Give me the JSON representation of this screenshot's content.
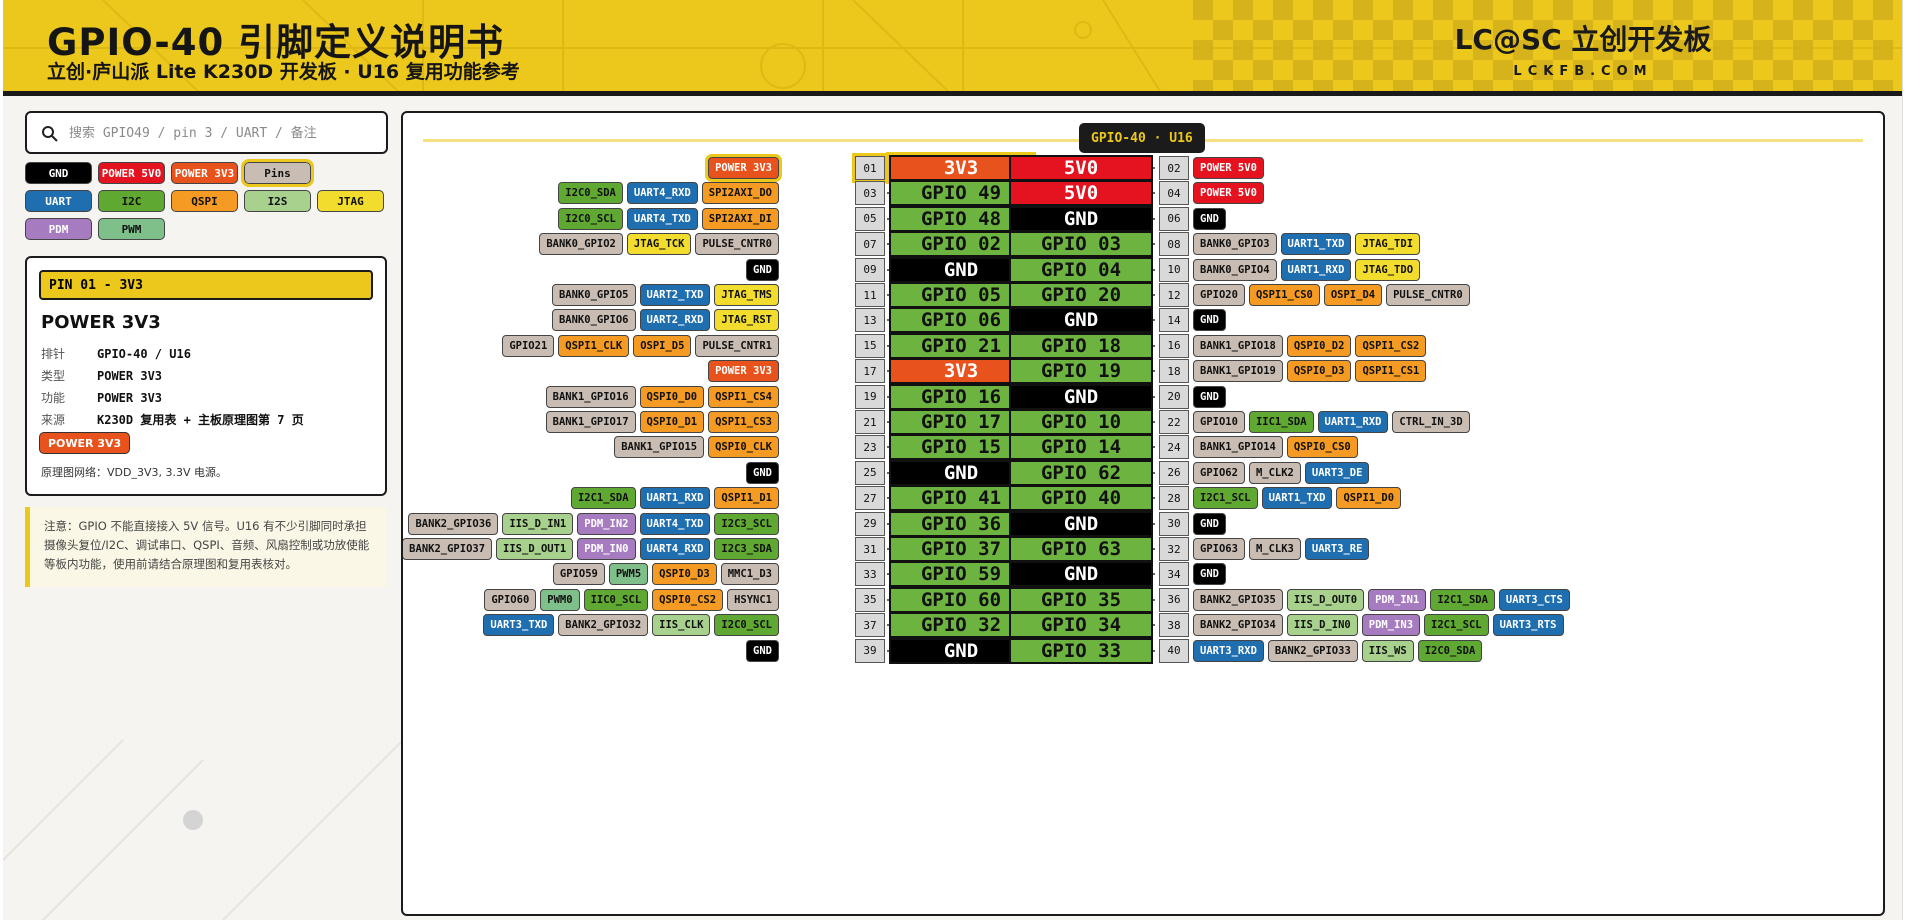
{
  "header": {
    "title": "GPIO-40 引脚定义说明书",
    "subtitle": "立创·庐山派 Lite K230D 开发板 · U16 复用功能参考",
    "brand": "LC@SC 立创开发板",
    "brand_url": "LCKFB.COM"
  },
  "search": {
    "placeholder": "搜索 GPIO49 / pin 3 / UART / 备注",
    "icon": "search-icon"
  },
  "legend": [
    {
      "label": "GND",
      "type": "GND"
    },
    {
      "label": "POWER 5V0",
      "type": "P5"
    },
    {
      "label": "POWER 3V3",
      "type": "P3"
    },
    {
      "label": "Pins",
      "type": "PIN",
      "selected": true
    },
    {
      "label": "UART",
      "type": "UART"
    },
    {
      "label": "I2C",
      "type": "I2C"
    },
    {
      "label": "QSPI",
      "type": "QSPI"
    },
    {
      "label": "I2S",
      "type": "I2S"
    },
    {
      "label": "JTAG",
      "type": "JTAG"
    },
    {
      "label": "PDM",
      "type": "PDM"
    },
    {
      "label": "PWM",
      "type": "PWM"
    }
  ],
  "info": {
    "header": "PIN 01 - 3V3",
    "name": "POWER 3V3",
    "rows": [
      {
        "k": "排针",
        "v": "GPIO-40 / U16"
      },
      {
        "k": "类型",
        "v": "POWER 3V3"
      },
      {
        "k": "功能",
        "v": "POWER 3V3"
      },
      {
        "k": "来源",
        "v": "K230D 复用表 + 主板原理图第 7 页"
      }
    ],
    "tag": "POWER 3V3",
    "note": "原理图网络：VDD_3V3, 3.3V 电源。"
  },
  "warning": "注意：GPIO 不能直接接入 5V 信号。U16 有不少引脚同时承担摄像头复位/I2C、调试串口、QSPI、音频、风扇控制或功放使能等板内功能，使用前请结合原理图和复用表核对。",
  "board_title": "GPIO-40 · U16",
  "colors": {
    "GND": "#000000",
    "P5": "#e5121f",
    "P3": "#e8521d",
    "GPIO": "#6cb33f",
    "UART": "#1f6eaf",
    "I2C": "#5fa832",
    "QSPI": "#f59b23",
    "I2S": "#a9d18e",
    "JTAG": "#f2dc2e",
    "PDM": "#a77bbf",
    "PWM": "#7fc08a",
    "MISC": "#c9bdb3",
    "accent": "#ecc81c"
  },
  "pins": [
    {
      "ln": "01",
      "rn": "02",
      "l": "3V3",
      "lt": "P3",
      "r": "5V0",
      "rt": "P5",
      "lf": [
        {
          "t": "POWER 3V3",
          "c": "P3",
          "sel": true
        }
      ],
      "rf": [
        {
          "t": "POWER 5V0",
          "c": "P5"
        }
      ]
    },
    {
      "ln": "03",
      "rn": "04",
      "l": "GPIO 49",
      "lt": "GPIO",
      "r": "5V0",
      "rt": "P5",
      "lf": [
        {
          "t": "I2C0_SDA",
          "c": "I2C"
        },
        {
          "t": "UART4_RXD",
          "c": "UART"
        },
        {
          "t": "SPI2AXI_DO",
          "c": "QSPI"
        }
      ],
      "rf": [
        {
          "t": "POWER 5V0",
          "c": "P5"
        }
      ]
    },
    {
      "ln": "05",
      "rn": "06",
      "l": "GPIO 48",
      "lt": "GPIO",
      "r": "GND",
      "rt": "GND",
      "lf": [
        {
          "t": "I2C0_SCL",
          "c": "I2C"
        },
        {
          "t": "UART4_TXD",
          "c": "UART"
        },
        {
          "t": "SPI2AXI_DI",
          "c": "QSPI"
        }
      ],
      "rf": [
        {
          "t": "GND",
          "c": "GND"
        }
      ]
    },
    {
      "ln": "07",
      "rn": "08",
      "l": "GPIO 02",
      "lt": "GPIO",
      "r": "GPIO 03",
      "rt": "GPIO",
      "lf": [
        {
          "t": "BANK0_GPIO2",
          "c": "MISC"
        },
        {
          "t": "JTAG_TCK",
          "c": "JTAG"
        },
        {
          "t": "PULSE_CNTR0",
          "c": "MISC"
        }
      ],
      "rf": [
        {
          "t": "BANK0_GPIO3",
          "c": "MISC"
        },
        {
          "t": "UART1_TXD",
          "c": "UART"
        },
        {
          "t": "JTAG_TDI",
          "c": "JTAG"
        }
      ]
    },
    {
      "ln": "09",
      "rn": "10",
      "l": "GND",
      "lt": "GND",
      "r": "GPIO 04",
      "rt": "GPIO",
      "lf": [
        {
          "t": "GND",
          "c": "GND"
        }
      ],
      "rf": [
        {
          "t": "BANK0_GPIO4",
          "c": "MISC"
        },
        {
          "t": "UART1_RXD",
          "c": "UART"
        },
        {
          "t": "JTAG_TDO",
          "c": "JTAG"
        }
      ]
    },
    {
      "ln": "11",
      "rn": "12",
      "l": "GPIO 05",
      "lt": "GPIO",
      "r": "GPIO 20",
      "rt": "GPIO",
      "lf": [
        {
          "t": "BANK0_GPIO5",
          "c": "MISC"
        },
        {
          "t": "UART2_TXD",
          "c": "UART"
        },
        {
          "t": "JTAG_TMS",
          "c": "JTAG"
        }
      ],
      "rf": [
        {
          "t": "GPIO20",
          "c": "MISC"
        },
        {
          "t": "QSPI1_CS0",
          "c": "QSPI"
        },
        {
          "t": "OSPI_D4",
          "c": "QSPI"
        },
        {
          "t": "PULSE_CNTR0",
          "c": "MISC"
        }
      ]
    },
    {
      "ln": "13",
      "rn": "14",
      "l": "GPIO 06",
      "lt": "GPIO",
      "r": "GND",
      "rt": "GND",
      "lf": [
        {
          "t": "BANK0_GPIO6",
          "c": "MISC"
        },
        {
          "t": "UART2_RXD",
          "c": "UART"
        },
        {
          "t": "JTAG_RST",
          "c": "JTAG"
        }
      ],
      "rf": [
        {
          "t": "GND",
          "c": "GND"
        }
      ]
    },
    {
      "ln": "15",
      "rn": "16",
      "l": "GPIO 21",
      "lt": "GPIO",
      "r": "GPIO 18",
      "rt": "GPIO",
      "lf": [
        {
          "t": "GPIO21",
          "c": "MISC"
        },
        {
          "t": "QSPI1_CLK",
          "c": "QSPI"
        },
        {
          "t": "OSPI_D5",
          "c": "QSPI"
        },
        {
          "t": "PULSE_CNTR1",
          "c": "MISC"
        }
      ],
      "rf": [
        {
          "t": "BANK1_GPIO18",
          "c": "MISC"
        },
        {
          "t": "QSPI0_D2",
          "c": "QSPI"
        },
        {
          "t": "QSPI1_CS2",
          "c": "QSPI"
        }
      ]
    },
    {
      "ln": "17",
      "rn": "18",
      "l": "3V3",
      "lt": "P3",
      "r": "GPIO 19",
      "rt": "GPIO",
      "lf": [
        {
          "t": "POWER 3V3",
          "c": "P3"
        }
      ],
      "rf": [
        {
          "t": "BANK1_GPIO19",
          "c": "MISC"
        },
        {
          "t": "QSPI0_D3",
          "c": "QSPI"
        },
        {
          "t": "QSPI1_CS1",
          "c": "QSPI"
        }
      ]
    },
    {
      "ln": "19",
      "rn": "20",
      "l": "GPIO 16",
      "lt": "GPIO",
      "r": "GND",
      "rt": "GND",
      "lf": [
        {
          "t": "BANK1_GPIO16",
          "c": "MISC"
        },
        {
          "t": "QSPI0_D0",
          "c": "QSPI"
        },
        {
          "t": "QSPI1_CS4",
          "c": "QSPI"
        }
      ],
      "rf": [
        {
          "t": "GND",
          "c": "GND"
        }
      ]
    },
    {
      "ln": "21",
      "rn": "22",
      "l": "GPIO 17",
      "lt": "GPIO",
      "r": "GPIO 10",
      "rt": "GPIO",
      "lf": [
        {
          "t": "BANK1_GPIO17",
          "c": "MISC"
        },
        {
          "t": "QSPI0_D1",
          "c": "QSPI"
        },
        {
          "t": "QSPI1_CS3",
          "c": "QSPI"
        }
      ],
      "rf": [
        {
          "t": "GPIO10",
          "c": "MISC"
        },
        {
          "t": "IIC1_SDA",
          "c": "I2C"
        },
        {
          "t": "UART1_RXD",
          "c": "UART"
        },
        {
          "t": "CTRL_IN_3D",
          "c": "MISC"
        }
      ]
    },
    {
      "ln": "23",
      "rn": "24",
      "l": "GPIO 15",
      "lt": "GPIO",
      "r": "GPIO 14",
      "rt": "GPIO",
      "lf": [
        {
          "t": "BANK1_GPIO15",
          "c": "MISC"
        },
        {
          "t": "QSPI0_CLK",
          "c": "QSPI"
        }
      ],
      "rf": [
        {
          "t": "BANK1_GPIO14",
          "c": "MISC"
        },
        {
          "t": "QSPI0_CS0",
          "c": "QSPI"
        }
      ]
    },
    {
      "ln": "25",
      "rn": "26",
      "l": "GND",
      "lt": "GND",
      "r": "GPIO 62",
      "rt": "GPIO",
      "lf": [
        {
          "t": "GND",
          "c": "GND"
        }
      ],
      "rf": [
        {
          "t": "GPIO62",
          "c": "MISC"
        },
        {
          "t": "M_CLK2",
          "c": "MISC"
        },
        {
          "t": "UART3_DE",
          "c": "UART"
        }
      ]
    },
    {
      "ln": "27",
      "rn": "28",
      "l": "GPIO 41",
      "lt": "GPIO",
      "r": "GPIO 40",
      "rt": "GPIO",
      "lf": [
        {
          "t": "I2C1_SDA",
          "c": "I2C"
        },
        {
          "t": "UART1_RXD",
          "c": "UART"
        },
        {
          "t": "QSPI1_D1",
          "c": "QSPI"
        }
      ],
      "rf": [
        {
          "t": "I2C1_SCL",
          "c": "I2C"
        },
        {
          "t": "UART1_TXD",
          "c": "UART"
        },
        {
          "t": "QSPI1_D0",
          "c": "QSPI"
        }
      ]
    },
    {
      "ln": "29",
      "rn": "30",
      "l": "GPIO 36",
      "lt": "GPIO",
      "r": "GND",
      "rt": "GND",
      "lf": [
        {
          "t": "BANK2_GPIO36",
          "c": "MISC"
        },
        {
          "t": "IIS_D_IN1",
          "c": "I2S"
        },
        {
          "t": "PDM_IN2",
          "c": "PDM"
        },
        {
          "t": "UART4_TXD",
          "c": "UART"
        },
        {
          "t": "I2C3_SCL",
          "c": "I2C"
        }
      ],
      "rf": [
        {
          "t": "GND",
          "c": "GND"
        }
      ]
    },
    {
      "ln": "31",
      "rn": "32",
      "l": "GPIO 37",
      "lt": "GPIO",
      "r": "GPIO 63",
      "rt": "GPIO",
      "lf": [
        {
          "t": "BANK2_GPIO37",
          "c": "MISC"
        },
        {
          "t": "IIS_D_OUT1",
          "c": "I2S"
        },
        {
          "t": "PDM_IN0",
          "c": "PDM"
        },
        {
          "t": "UART4_RXD",
          "c": "UART"
        },
        {
          "t": "I2C3_SDA",
          "c": "I2C"
        }
      ],
      "rf": [
        {
          "t": "GPIO63",
          "c": "MISC"
        },
        {
          "t": "M_CLK3",
          "c": "MISC"
        },
        {
          "t": "UART3_RE",
          "c": "UART"
        }
      ]
    },
    {
      "ln": "33",
      "rn": "34",
      "l": "GPIO 59",
      "lt": "GPIO",
      "r": "GND",
      "rt": "GND",
      "lf": [
        {
          "t": "GPIO59",
          "c": "MISC"
        },
        {
          "t": "PWM5",
          "c": "PWM"
        },
        {
          "t": "QSPI0_D3",
          "c": "QSPI"
        },
        {
          "t": "MMC1_D3",
          "c": "MISC"
        }
      ],
      "rf": [
        {
          "t": "GND",
          "c": "GND"
        }
      ]
    },
    {
      "ln": "35",
      "rn": "36",
      "l": "GPIO 60",
      "lt": "GPIO",
      "r": "GPIO 35",
      "rt": "GPIO",
      "lf": [
        {
          "t": "GPIO60",
          "c": "MISC"
        },
        {
          "t": "PWM0",
          "c": "PWM"
        },
        {
          "t": "IIC0_SCL",
          "c": "I2C"
        },
        {
          "t": "QSPI0_CS2",
          "c": "QSPI"
        },
        {
          "t": "HSYNC1",
          "c": "MISC"
        }
      ],
      "rf": [
        {
          "t": "BANK2_GPIO35",
          "c": "MISC"
        },
        {
          "t": "IIS_D_OUT0",
          "c": "I2S"
        },
        {
          "t": "PDM_IN1",
          "c": "PDM"
        },
        {
          "t": "I2C1_SDA",
          "c": "I2C"
        },
        {
          "t": "UART3_CTS",
          "c": "UART"
        }
      ]
    },
    {
      "ln": "37",
      "rn": "38",
      "l": "GPIO 32",
      "lt": "GPIO",
      "r": "GPIO 34",
      "rt": "GPIO",
      "lf": [
        {
          "t": "UART3_TXD",
          "c": "UART"
        },
        {
          "t": "BANK2_GPIO32",
          "c": "MISC"
        },
        {
          "t": "IIS_CLK",
          "c": "I2S"
        },
        {
          "t": "I2C0_SCL",
          "c": "I2C"
        }
      ],
      "rf": [
        {
          "t": "BANK2_GPIO34",
          "c": "MISC"
        },
        {
          "t": "IIS_D_IN0",
          "c": "I2S"
        },
        {
          "t": "PDM_IN3",
          "c": "PDM"
        },
        {
          "t": "I2C1_SCL",
          "c": "I2C"
        },
        {
          "t": "UART3_RTS",
          "c": "UART"
        }
      ]
    },
    {
      "ln": "39",
      "rn": "40",
      "l": "GND",
      "lt": "GND",
      "r": "GPIO 33",
      "rt": "GPIO",
      "lf": [
        {
          "t": "GND",
          "c": "GND"
        }
      ],
      "rf": [
        {
          "t": "UART3_RXD",
          "c": "UART"
        },
        {
          "t": "BANK2_GPIO33",
          "c": "MISC"
        },
        {
          "t": "IIS_WS",
          "c": "I2S"
        },
        {
          "t": "I2C0_SDA",
          "c": "I2C"
        }
      ]
    }
  ]
}
